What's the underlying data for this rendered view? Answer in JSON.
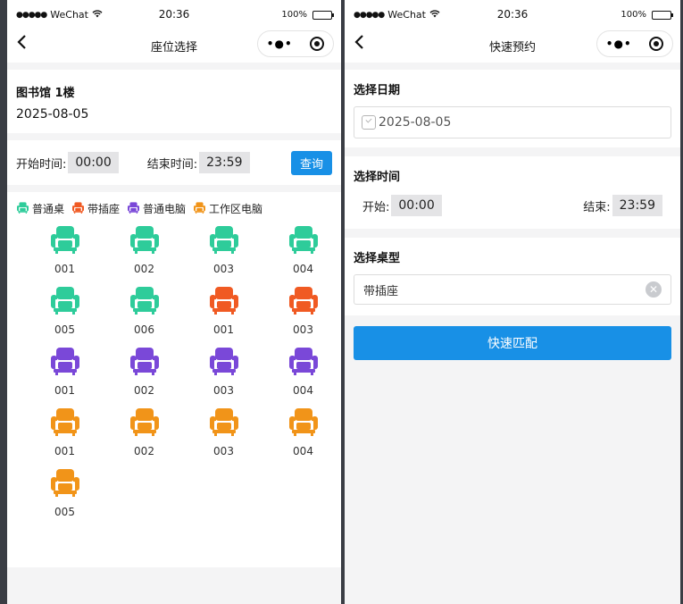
{
  "status_bar": {
    "carrier": "WeChat",
    "time": "20:36",
    "battery": "100%"
  },
  "colors": {
    "regular": "#2ecc9a",
    "power": "#f05a23",
    "pc": "#7a48d8",
    "work_pc": "#f19419",
    "primary": "#1890e6"
  },
  "left": {
    "nav_title": "座位选择",
    "library": "图书馆 1楼",
    "date": "2025-08-05",
    "start_label": "开始时间:",
    "start_value": "00:00",
    "end_label": "结束时间:",
    "end_value": "23:59",
    "query_label": "查询",
    "legend": [
      {
        "label": "普通桌",
        "color": "#2ecc9a"
      },
      {
        "label": "带插座",
        "color": "#f05a23"
      },
      {
        "label": "普通电脑",
        "color": "#7a48d8"
      },
      {
        "label": "工作区电脑",
        "color": "#f19419"
      }
    ],
    "seats": [
      {
        "num": "001",
        "color": "#2ecc9a"
      },
      {
        "num": "002",
        "color": "#2ecc9a"
      },
      {
        "num": "003",
        "color": "#2ecc9a"
      },
      {
        "num": "004",
        "color": "#2ecc9a"
      },
      {
        "num": "005",
        "color": "#2ecc9a"
      },
      {
        "num": "006",
        "color": "#2ecc9a"
      },
      {
        "num": "001",
        "color": "#f05a23"
      },
      {
        "num": "003",
        "color": "#f05a23"
      },
      {
        "num": "001",
        "color": "#7a48d8"
      },
      {
        "num": "002",
        "color": "#7a48d8"
      },
      {
        "num": "003",
        "color": "#7a48d8"
      },
      {
        "num": "004",
        "color": "#7a48d8"
      },
      {
        "num": "001",
        "color": "#f19419"
      },
      {
        "num": "002",
        "color": "#f19419"
      },
      {
        "num": "003",
        "color": "#f19419"
      },
      {
        "num": "004",
        "color": "#f19419"
      },
      {
        "num": "005",
        "color": "#f19419"
      }
    ]
  },
  "right": {
    "nav_title": "快速预约",
    "date_title": "选择日期",
    "date_value": "2025-08-05",
    "time_title": "选择时间",
    "start_label": "开始:",
    "start_value": "00:00",
    "end_label": "结束:",
    "end_value": "23:59",
    "type_title": "选择桌型",
    "type_value": "带插座",
    "match_label": "快速匹配"
  }
}
